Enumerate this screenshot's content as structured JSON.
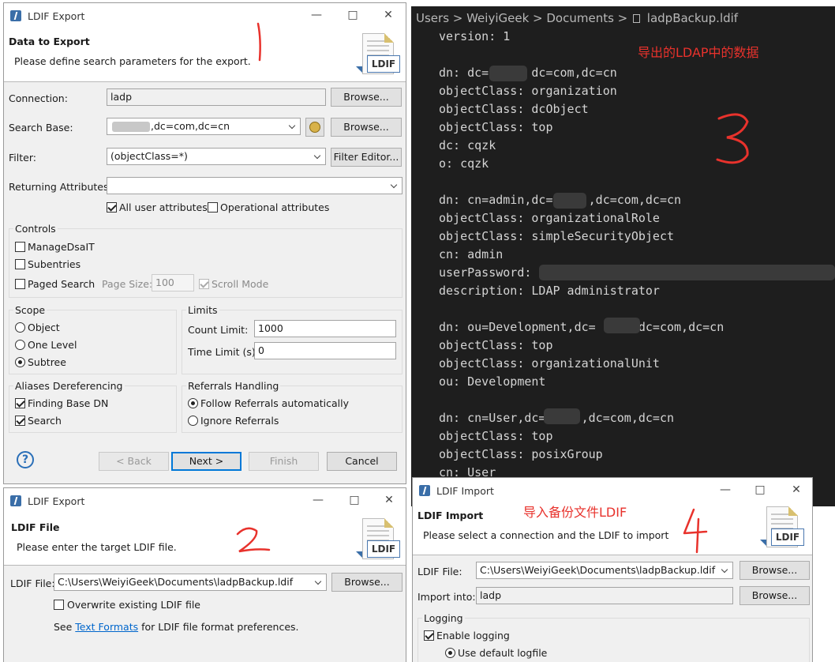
{
  "terminal": {
    "breadcrumb": "Users > WeiyiGeek > Documents > ",
    "file_name": "ladpBackup.ldif",
    "annotation": "导出的LDAP中的数据",
    "lines": [
      "version: 1",
      "",
      "dn: dc=      dc=com,dc=cn",
      "objectClass: organization",
      "objectClass: dcObject",
      "objectClass: top",
      "dc: cqzk",
      "o: cqzk",
      "",
      "dn: cn=admin,dc=    :,dc=com,dc=cn",
      "objectClass: organizationalRole",
      "objectClass: simpleSecurityObject",
      "cn: admin",
      "userPassword:",
      "description: LDAP administrator",
      "",
      "dn: ou=Development,dc=      dc=com,dc=cn",
      "objectClass: top",
      "objectClass: organizationalUnit",
      "ou: Development",
      "",
      "dn: cn=User,dc=     ,dc=com,dc=cn",
      "objectClass: top",
      "objectClass: posixGroup",
      "cn: User"
    ]
  },
  "export1": {
    "window_title": "LDIF Export",
    "header_title": "Data to Export",
    "header_desc": "Please define search parameters for the export.",
    "icon_label": "LDIF",
    "connection_label": "Connection:",
    "connection_value": "ladp",
    "search_base_label": "Search Base:",
    "search_base_value": ",dc=com,dc=cn",
    "filter_label": "Filter:",
    "filter_value": "(objectClass=*)",
    "filter_editor": "Filter Editor...",
    "returning_label": "Returning Attributes:",
    "browse": "Browse...",
    "all_user_attrs": "All user attributes",
    "operational_attrs": "Operational attributes",
    "controls": {
      "title": "Controls",
      "manage": "ManageDsaIT",
      "subentries": "Subentries",
      "paged": "Paged Search",
      "page_size_label": "Page Size:",
      "page_size_value": "100",
      "scroll_mode": "Scroll Mode"
    },
    "scope": {
      "title": "Scope",
      "object": "Object",
      "one_level": "One Level",
      "subtree": "Subtree"
    },
    "limits": {
      "title": "Limits",
      "count_label": "Count Limit:",
      "count_value": "1000",
      "time_label": "Time Limit (s):",
      "time_value": "0"
    },
    "aliases": {
      "title": "Aliases Dereferencing",
      "finding": "Finding Base DN",
      "search": "Search"
    },
    "referrals": {
      "title": "Referrals Handling",
      "follow": "Follow Referrals automatically",
      "ignore": "Ignore Referrals"
    },
    "buttons": {
      "help": "?",
      "back": "< Back",
      "next": "Next >",
      "finish": "Finish",
      "cancel": "Cancel"
    }
  },
  "export2": {
    "window_title": "LDIF Export",
    "header_title": "LDIF File",
    "header_desc": "Please enter the target LDIF file.",
    "icon_label": "LDIF",
    "file_label": "LDIF File:",
    "file_value": "C:\\Users\\WeiyiGeek\\Documents\\ladpBackup.ldif",
    "browse": "Browse...",
    "overwrite": "Overwrite existing LDIF file",
    "see_prefix": "See ",
    "see_link": "Text Formats",
    "see_suffix": " for LDIF file format preferences."
  },
  "import": {
    "window_title": "LDIF Import",
    "header_title": "LDIF Import",
    "header_desc": "Please select a connection and the LDIF to import",
    "annotation": "导入备份文件LDIF",
    "icon_label": "LDIF",
    "file_label": "LDIF File:",
    "file_value": "C:\\Users\\WeiyiGeek\\Documents\\ladpBackup.ldif",
    "import_label": "Import into:",
    "import_value": "ladp",
    "browse": "Browse...",
    "logging_title": "Logging",
    "enable_logging": "Enable logging",
    "use_default": "Use default logfile"
  },
  "handwritten": {
    "one": "1",
    "two": "2",
    "three": "3",
    "four": "4"
  },
  "colors": {
    "annotation": "#e8322c",
    "accent": "#0078d7",
    "terminal_bg": "#1e1e1e"
  }
}
